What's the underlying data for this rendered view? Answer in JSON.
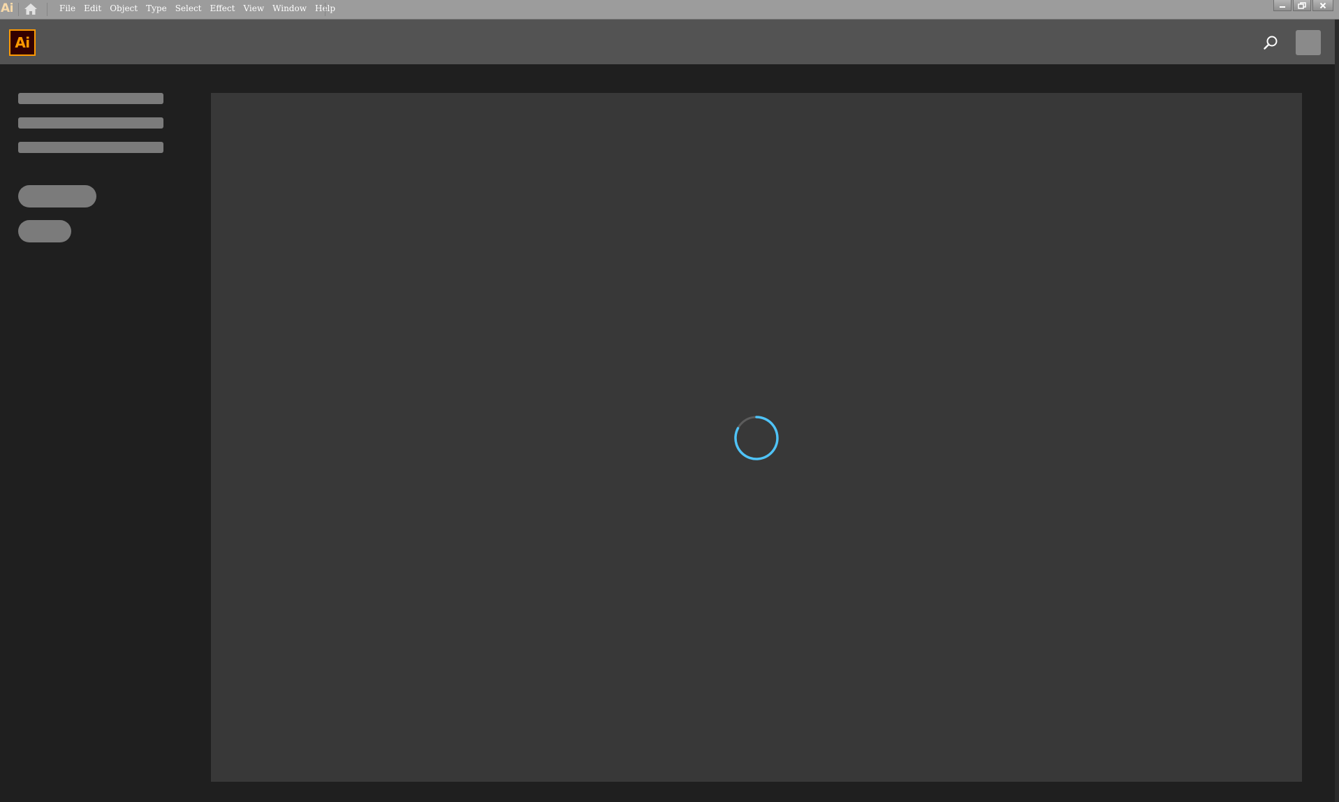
{
  "titlebar": {
    "logo_text": "Ai",
    "menu": [
      {
        "label": "File"
      },
      {
        "label": "Edit"
      },
      {
        "label": "Object"
      },
      {
        "label": "Type"
      },
      {
        "label": "Select"
      },
      {
        "label": "Effect"
      },
      {
        "label": "View"
      },
      {
        "label": "Window"
      },
      {
        "label": "Help"
      }
    ],
    "icons": {
      "home": "home-icon",
      "minimize": "minimize-icon",
      "restore": "restore-icon",
      "close": "close-icon"
    }
  },
  "appbar": {
    "logo_text": "Ai",
    "logo_colors": {
      "background": "#330000",
      "foreground": "#ff9a00"
    },
    "search_icon": "search-icon",
    "avatar_icon": "avatar-placeholder"
  },
  "main": {
    "state": "loading",
    "spinner_colors": {
      "arc": "#4fc3f7",
      "track": "#5c5c5c"
    }
  }
}
